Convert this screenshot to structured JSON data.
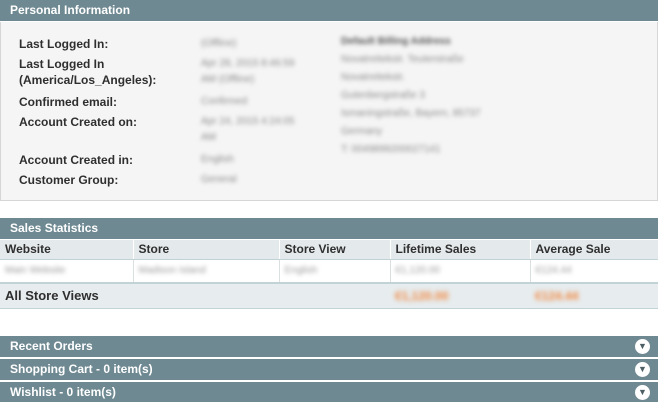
{
  "personal_info": {
    "title": "Personal Information",
    "fields": [
      {
        "label": "Last Logged In:",
        "value": "(Offline)"
      },
      {
        "label": "Last Logged In (America/Los_Angeles):",
        "value": "Apr 28, 2015 8:46:59 AM (Offline)"
      },
      {
        "label": "Confirmed email:",
        "value": "Confirmed"
      },
      {
        "label": "Account Created on:",
        "value": "Apr 24, 2015 4:24:05 AM"
      },
      {
        "label": "Account Created in:",
        "value": "English"
      },
      {
        "label": "Customer Group:",
        "value": "General"
      }
    ],
    "labels": {
      "last_logged_in": "Last Logged In:",
      "last_logged_in_tz_line1": "Last Logged In",
      "last_logged_in_tz_line2": "(America/Los_Angeles):",
      "confirmed_email": "Confirmed email:",
      "account_created_on": "Account Created on:",
      "account_created_in": "Account Created in:",
      "customer_group": "Customer Group:"
    },
    "values": {
      "last_logged_in": "(Offline)",
      "last_logged_in_tz_line1": "Apr 28, 2015 8:46:59",
      "last_logged_in_tz_line2": "AM (Offline)",
      "confirmed_email": "Confirmed",
      "account_created_on_line1": "Apr 24, 2015 4:24:05",
      "account_created_on_line2": "AM",
      "account_created_in": "English",
      "customer_group": "General"
    },
    "billing_address": {
      "title": "Default Billing Address",
      "lines": [
        "Novatreitekstr. Teuterstraße",
        "Novatreitekstr.",
        "Gutenbergstraße 3",
        "Ismaningstraße, Bayern, 85737",
        "Germany",
        "T: 0049899200027141"
      ]
    }
  },
  "sales_statistics": {
    "title": "Sales Statistics",
    "columns": [
      "Website",
      "Store",
      "Store View",
      "Lifetime Sales",
      "Average Sale"
    ],
    "rows": [
      {
        "website": "Main Website",
        "store": "Madison Island",
        "store_view": "English",
        "lifetime_sales": "€1,120.00",
        "average_sale": "€124.44"
      }
    ],
    "total": {
      "label": "All Store Views",
      "lifetime_sales": "€1,120.00",
      "average_sale": "€124.44"
    }
  },
  "collapsibles": [
    {
      "label": "Recent Orders"
    },
    {
      "label": "Shopping Cart - 0 item(s)"
    },
    {
      "label": "Wishlist - 0 item(s)"
    }
  ],
  "icons": {
    "expand": "chevron-down-icon"
  }
}
